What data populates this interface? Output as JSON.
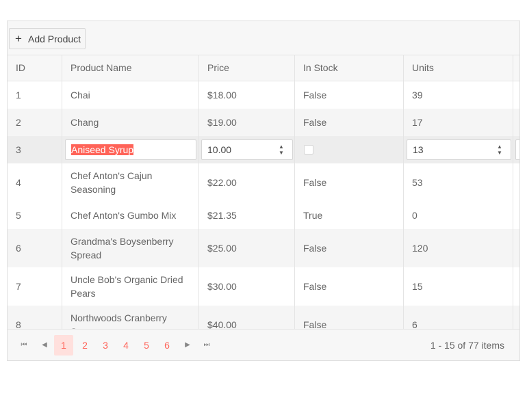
{
  "toolbar": {
    "add_label": "Add Product",
    "add_icon": "plus-icon"
  },
  "columns": [
    "ID",
    "Product Name",
    "Price",
    "In Stock",
    "Units"
  ],
  "rows": [
    {
      "id": "1",
      "name": "Chai",
      "price": "$18.00",
      "stock": "False",
      "units": "39"
    },
    {
      "id": "2",
      "name": "Chang",
      "price": "$19.00",
      "stock": "False",
      "units": "17"
    },
    {
      "id": "3",
      "name": "Aniseed Syrup",
      "price": "10.00",
      "stock": "",
      "units": "13",
      "editing": true
    },
    {
      "id": "4",
      "name": "Chef Anton's Cajun Seasoning",
      "price": "$22.00",
      "stock": "False",
      "units": "53"
    },
    {
      "id": "5",
      "name": "Chef Anton's Gumbo Mix",
      "price": "$21.35",
      "stock": "True",
      "units": "0"
    },
    {
      "id": "6",
      "name": "Grandma's Boysenberry Spread",
      "price": "$25.00",
      "stock": "False",
      "units": "120"
    },
    {
      "id": "7",
      "name": "Uncle Bob's Organic Dried Pears",
      "price": "$30.00",
      "stock": "False",
      "units": "15"
    },
    {
      "id": "8",
      "name": "Northwoods Cranberry Sauce",
      "price": "$40.00",
      "stock": "False",
      "units": "6"
    }
  ],
  "pager": {
    "pages": [
      "1",
      "2",
      "3",
      "4",
      "5",
      "6"
    ],
    "current": "1",
    "info": "1 - 15 of 77 items"
  },
  "colors": {
    "accent": "#ff6358",
    "selected_page_bg": "#ffe0dd"
  }
}
